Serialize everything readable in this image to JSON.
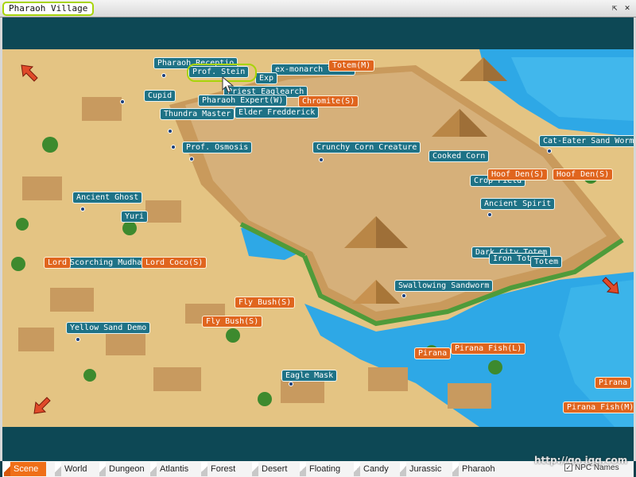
{
  "window": {
    "title": "Pharaoh Village"
  },
  "npc_labels": [
    {
      "id": "pharaoh-reception",
      "text": "Pharaoh Receptio"
    },
    {
      "id": "prof-stein",
      "text": "Prof. Stein"
    },
    {
      "id": "ex-monarch-totem",
      "text": "ex-monarch Totem"
    },
    {
      "id": "expert-partial",
      "text": "Exp"
    },
    {
      "id": "priest-eaglearch",
      "text": "Priest Eaglearch"
    },
    {
      "id": "cupid",
      "text": "Cupid"
    },
    {
      "id": "pharaoh-expert",
      "text": "Pharaoh Expert(W)"
    },
    {
      "id": "thundra-master",
      "text": "Thundra Master"
    },
    {
      "id": "elder-fredderick",
      "text": "Elder Fredderick"
    },
    {
      "id": "prof-osmosis",
      "text": "Prof. Osmosis"
    },
    {
      "id": "crunchy-corn-creature",
      "text": "Crunchy Corn Creature"
    },
    {
      "id": "cooked-corn",
      "text": "Cooked Corn"
    },
    {
      "id": "cat-eater-sand-worm",
      "text": "Cat-Eater Sand Worm"
    },
    {
      "id": "crop-field",
      "text": "Crop Field"
    },
    {
      "id": "ancient-ghost",
      "text": "Ancient Ghost"
    },
    {
      "id": "yuri",
      "text": "Yuri"
    },
    {
      "id": "ancient-spirit",
      "text": "Ancient Spirit"
    },
    {
      "id": "dark-city-totem",
      "text": "Dark City Totem"
    },
    {
      "id": "iron-totem",
      "text": "Iron Totem"
    },
    {
      "id": "totem-partial",
      "text": "Totem"
    },
    {
      "id": "scorching-mudhand",
      "text": "Scorching Mudhand"
    },
    {
      "id": "swallowing-sandworm",
      "text": "Swallowing Sandworm"
    },
    {
      "id": "yellow-sand-demon",
      "text": "Yellow Sand Demo"
    },
    {
      "id": "eagle-mask",
      "text": "Eagle Mask"
    }
  ],
  "mob_labels": [
    {
      "id": "totem-m",
      "text": "Totem(M)"
    },
    {
      "id": "chromite-s",
      "text": "Chromite(S)"
    },
    {
      "id": "hoof-den-s-1",
      "text": "Hoof Den(S)"
    },
    {
      "id": "hoof-den-s-2",
      "text": "Hoof Den(S)"
    },
    {
      "id": "lord",
      "text": "Lord"
    },
    {
      "id": "lord-coco-s",
      "text": "Lord Coco(S)"
    },
    {
      "id": "fly-bush-s-1",
      "text": "Fly Bush(S)"
    },
    {
      "id": "fly-bush-s-2",
      "text": "Fly Bush(S)"
    },
    {
      "id": "pirana-partial",
      "text": "Pirana"
    },
    {
      "id": "pirana-fish-l",
      "text": "Pirana Fish(L)"
    },
    {
      "id": "pirana-right",
      "text": "Pirana"
    },
    {
      "id": "pirana-fish-m",
      "text": "Pirana Fish(M)"
    }
  ],
  "tabs": [
    "Scene",
    "World",
    "Dungeon",
    "Atlantis",
    "Forest",
    "Desert",
    "Floating",
    "Candy",
    "Jurassic",
    "Pharaoh"
  ],
  "active_tab": "Scene",
  "npc_names_toggle": {
    "label": "NPC Names",
    "checked": true
  },
  "watermark": "http://go.igg.com",
  "colors": {
    "npc_label": "#1e7286",
    "mob_label": "#e0651e",
    "highlight": "#a8d40a",
    "water": "#2ea8e6",
    "sand": "#e8c98a",
    "active_tab": "#ef6f18"
  }
}
